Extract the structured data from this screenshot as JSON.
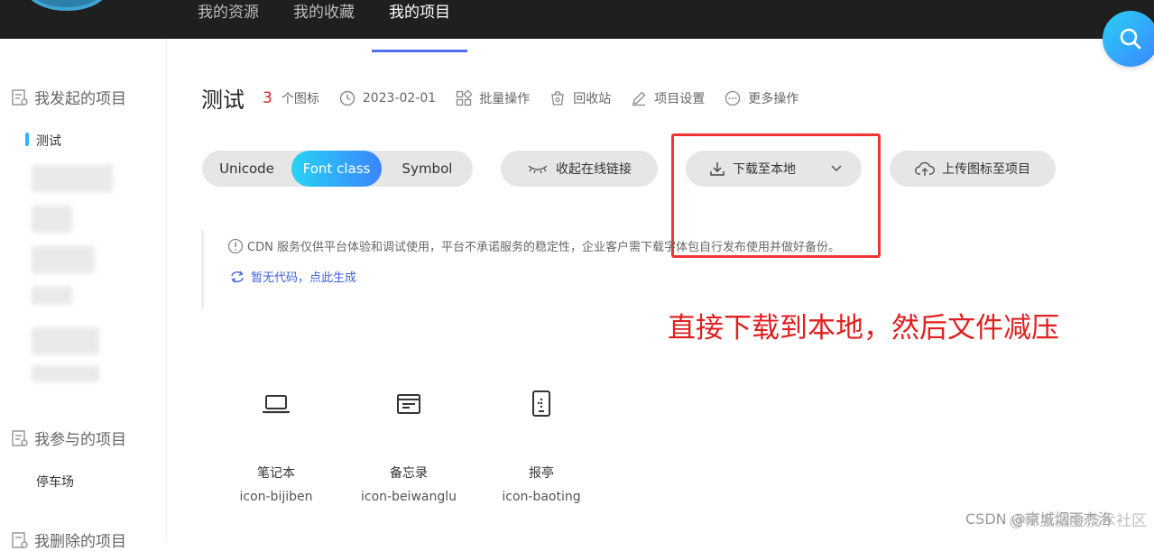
{
  "topnav": {
    "items": [
      {
        "label": "我的资源"
      },
      {
        "label": "我的收藏"
      },
      {
        "label": "我的项目"
      }
    ]
  },
  "sidebar": {
    "group1": "我发起的项目",
    "active_project": "测试",
    "group2": "我参与的项目",
    "joined_project": "停车场",
    "group3": "我删除的项目"
  },
  "project": {
    "title": "测试",
    "icon_count": "3",
    "icon_count_unit": "个图标",
    "date": "2023-02-01",
    "batch": "批量操作",
    "recycle": "回收站",
    "settings": "项目设置",
    "more": "更多操作"
  },
  "tabs": [
    "Unicode",
    "Font class",
    "Symbol"
  ],
  "actions": {
    "collapse_link": "收起在线链接",
    "download": "下载至本地",
    "upload": "上传图标至项目"
  },
  "notice": {
    "text": "CDN 服务仅供平台体验和调试使用，平台不承诺服务的稳定性，企业客户需下载字体包自行发布使用并做好备份。",
    "generate": "暂无代码，点此生成"
  },
  "annotation": "直接下载到本地，然后文件减压",
  "icons": [
    {
      "name": "笔记本",
      "code": "icon-bijiben",
      "icon": "laptop-icon"
    },
    {
      "name": "备忘录",
      "code": "icon-beiwanglu",
      "icon": "memo-icon"
    },
    {
      "name": "报亭",
      "code": "icon-baoting",
      "icon": "kiosk-icon"
    }
  ],
  "watermark": {
    "csdn": "CSDN @京城烟雨杰洛",
    "juejin": "@稀土掘金技术社区"
  },
  "colors": {
    "accent": "#3b84ff",
    "accent2": "#27d3f4",
    "annotation": "#e02020",
    "topbar": "#1f1f1f"
  }
}
